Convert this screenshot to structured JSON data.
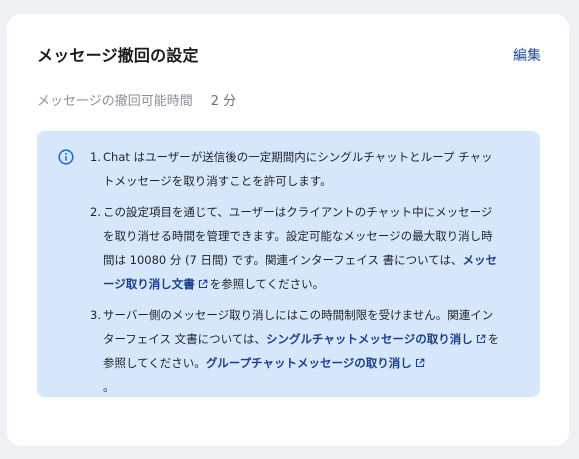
{
  "card": {
    "title": "メッセージ撤回の設定",
    "edit_label": "編集"
  },
  "setting": {
    "label": "メッセージの撤回可能時間",
    "value": "2 分"
  },
  "notice": {
    "icon": "info-icon",
    "items": [
      {
        "number": "1.",
        "text": "Chat はユーザーが送信後の一定期間内にシングルチャットとループ チャットメッセージを取り消すことを許可します。"
      },
      {
        "number": "2.",
        "text_before": "この設定項目を通じて、ユーザーはクライアントのチャット中にメッセージを取り消せる時間を管理できます。設定可能なメッセージの最大取り消し時間は 10080 分 (7 日間) です。関連インターフェイス 書については、",
        "link": "メッセージ取り消し文書",
        "text_after": "を参照してください。"
      },
      {
        "number": "3.",
        "text_before": "サーバー側のメッセージ取り消しにはこの時間制限を受けません。関連インターフェイス 文書については、",
        "link1": "シングルチャットメッセージの取り消し",
        "text_middle": "を参照してください。",
        "link2": "グループチャットメッセージの取り消し",
        "text_after": "。"
      }
    ]
  },
  "colors": {
    "accent": "#1a4fa0",
    "notice_bg": "#d6e6fb",
    "info_icon": "#1e6fd9"
  }
}
